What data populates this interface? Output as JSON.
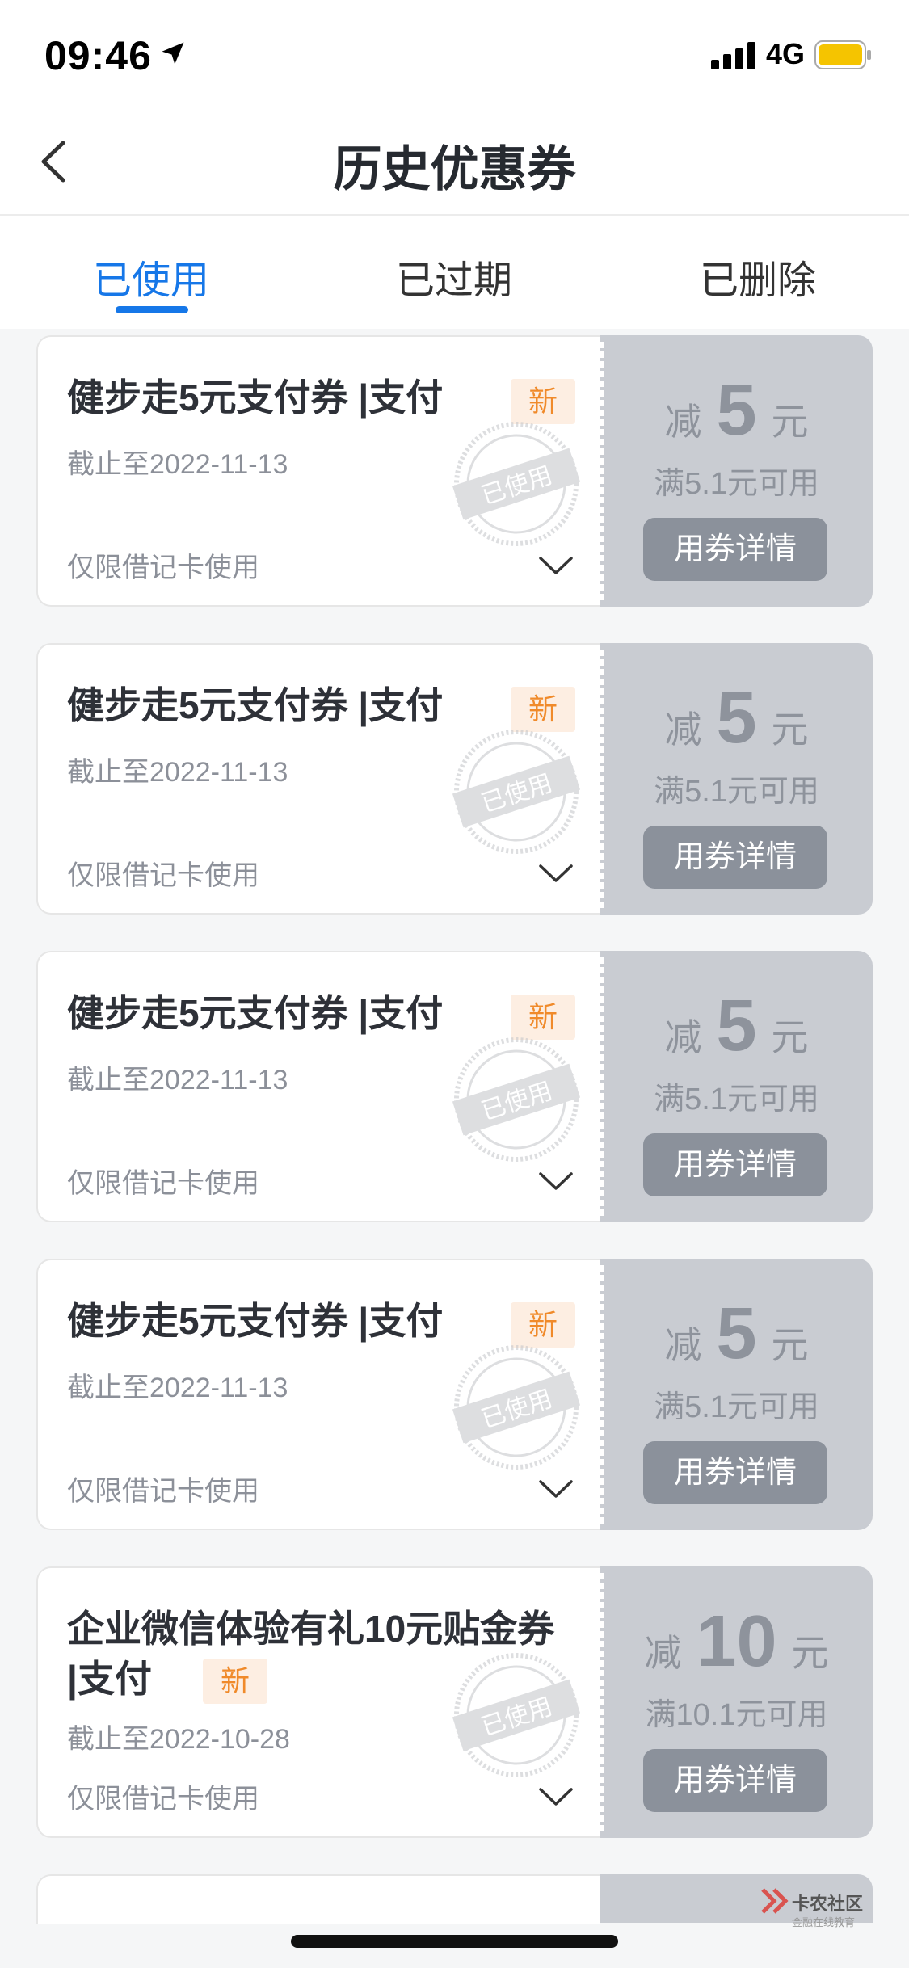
{
  "status_bar": {
    "time": "09:46",
    "network": "4G"
  },
  "nav": {
    "title": "历史优惠券"
  },
  "tabs": [
    {
      "label": "已使用",
      "active": true
    },
    {
      "label": "已过期",
      "active": false
    },
    {
      "label": "已删除",
      "active": false
    }
  ],
  "coupons": [
    {
      "title": "健步走5元支付券 |支付",
      "badge": "新",
      "expiry": "截止至2022-11-13",
      "restriction": "仅限借记卡使用",
      "stamp": "已使用",
      "amount_prefix": "减",
      "amount": "5",
      "amount_unit": "元",
      "condition": "满5.1元可用",
      "button": "用券详情"
    },
    {
      "title": "健步走5元支付券 |支付",
      "badge": "新",
      "expiry": "截止至2022-11-13",
      "restriction": "仅限借记卡使用",
      "stamp": "已使用",
      "amount_prefix": "减",
      "amount": "5",
      "amount_unit": "元",
      "condition": "满5.1元可用",
      "button": "用券详情"
    },
    {
      "title": "健步走5元支付券 |支付",
      "badge": "新",
      "expiry": "截止至2022-11-13",
      "restriction": "仅限借记卡使用",
      "stamp": "已使用",
      "amount_prefix": "减",
      "amount": "5",
      "amount_unit": "元",
      "condition": "满5.1元可用",
      "button": "用券详情"
    },
    {
      "title": "健步走5元支付券 |支付",
      "badge": "新",
      "expiry": "截止至2022-11-13",
      "restriction": "仅限借记卡使用",
      "stamp": "已使用",
      "amount_prefix": "减",
      "amount": "5",
      "amount_unit": "元",
      "condition": "满5.1元可用",
      "button": "用券详情"
    },
    {
      "title_line1": "企业微信体验有礼10元贴金券",
      "title_line2": "|支付",
      "badge": "新",
      "expiry": "截止至2022-10-28",
      "restriction": "仅限借记卡使用",
      "stamp": "已使用",
      "amount_prefix": "减",
      "amount": "10",
      "amount_unit": "元",
      "condition": "满10.1元可用",
      "button": "用券详情"
    }
  ],
  "watermark": {
    "name": "卡农社区",
    "tagline": "金融在线教育"
  },
  "colors": {
    "accent": "#1677e8",
    "badge_text": "#f08a2a",
    "coupon_right_bg": "#c9ccd2",
    "button_bg": "#8b919b"
  },
  "icons": [
    "location-arrow-icon",
    "signal-icon",
    "battery-icon",
    "back-chevron-icon",
    "chevron-down-icon",
    "used-stamp-icon"
  ]
}
